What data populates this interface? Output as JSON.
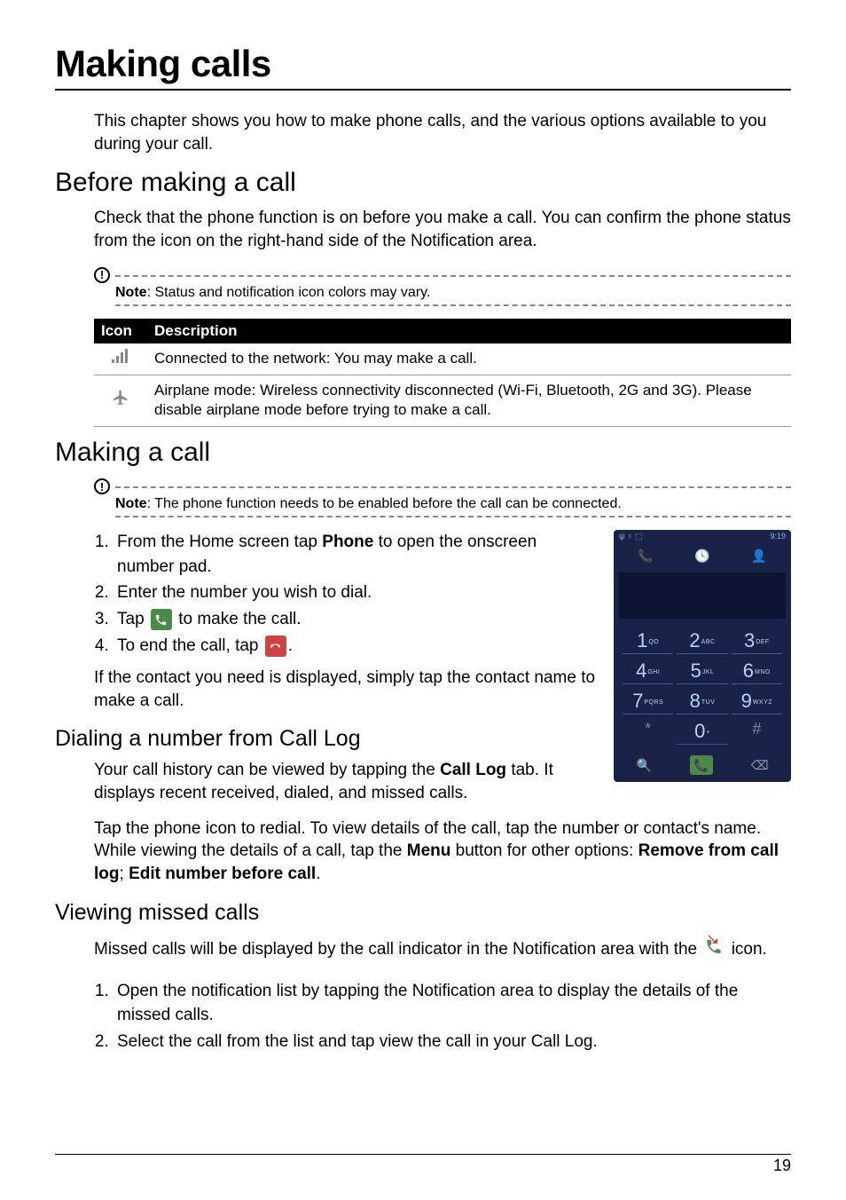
{
  "title": "Making calls",
  "intro": "This chapter shows you how to make phone calls, and the various options available to you during your call.",
  "section_before": {
    "heading": "Before making a call",
    "body": "Check that the phone function is on before you make a call. You can confirm the phone status from the icon on the right-hand side of the Notification area.",
    "note_label": "Note",
    "note_text": ": Status and notification icon colors may vary."
  },
  "icon_table": {
    "headers": {
      "icon": "Icon",
      "desc": "Description"
    },
    "rows": [
      {
        "icon_name": "signal-bars",
        "desc": "Connected to the network: You may make a call."
      },
      {
        "icon_name": "airplane",
        "desc": "Airplane mode: Wireless connectivity disconnected (Wi-Fi, Bluetooth, 2G and 3G). Please disable airplane mode before trying to make a call."
      }
    ]
  },
  "section_making": {
    "heading": "Making a call",
    "note_label": "Note",
    "note_text": ": The phone function needs to be enabled before the call can be connected.",
    "steps": {
      "s1_a": "From the Home screen tap ",
      "s1_bold": "Phone",
      "s1_b": " to open the onscreen number pad.",
      "s2": "Enter the number you wish to dial.",
      "s3_a": "Tap ",
      "s3_b": " to make the call.",
      "s4_a": "To end the call, tap ",
      "s4_b": "."
    },
    "after": "If the contact you need is displayed, simply tap the contact name to make a call."
  },
  "section_dial": {
    "heading": "Dialing a number from Call Log",
    "p1_a": "Your call history can be viewed by tapping the ",
    "p1_bold": "Call Log",
    "p1_b": " tab. It displays recent received, dialed, and missed calls.",
    "p2_a": "Tap the phone icon to redial. To view details of the call, tap the number or contact's name. While viewing the details of a call, tap the ",
    "p2_bold1": "Menu",
    "p2_b": " button for other options: ",
    "p2_bold2": "Remove from call log",
    "p2_c": "; ",
    "p2_bold3": "Edit number before call",
    "p2_d": "."
  },
  "section_missed": {
    "heading": "Viewing missed calls",
    "p1_a": "Missed calls will be displayed by the call indicator in the Notification area with the ",
    "p1_b": " icon.",
    "steps": {
      "s1": "Open the notification list by tapping the Notification area to display the details of the missed calls.",
      "s2": "Select the call from the list and tap view the call in your Call Log."
    }
  },
  "phone_screenshot": {
    "status_right": "9:19",
    "keypad": [
      {
        "d": "1",
        "s": "QO"
      },
      {
        "d": "2",
        "s": "ABC"
      },
      {
        "d": "3",
        "s": "DEF"
      },
      {
        "d": "4",
        "s": "GHI"
      },
      {
        "d": "5",
        "s": "JKL"
      },
      {
        "d": "6",
        "s": "MNO"
      },
      {
        "d": "7",
        "s": "PQRS"
      },
      {
        "d": "8",
        "s": "TUV"
      },
      {
        "d": "9",
        "s": "WXYZ"
      },
      {
        "d": "*",
        "s": ""
      },
      {
        "d": "0",
        "s": "+"
      },
      {
        "d": "#",
        "s": ""
      }
    ]
  },
  "page_number": "19"
}
